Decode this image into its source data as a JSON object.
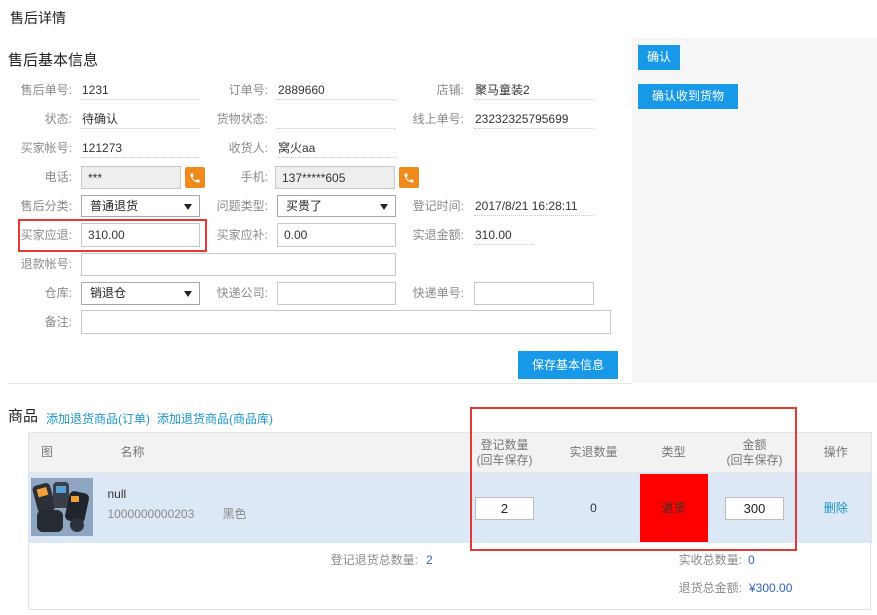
{
  "header": {
    "title": "售后详情"
  },
  "actions": {
    "confirm": "确认",
    "confirm_received": "确认收到货物"
  },
  "basic_info": {
    "title": "售后基本信息",
    "after_sale_no_label": "售后单号:",
    "after_sale_no": "1231",
    "order_no_label": "订单号:",
    "order_no": "2889660",
    "shop_label": "店铺:",
    "shop": "聚马童装2",
    "status_label": "状态:",
    "status": "待确认",
    "goods_status_label": "货物状态:",
    "online_no_label": "线上单号:",
    "online_no": "23232325795699",
    "buyer_account_label": "买家帐号:",
    "buyer_account": "121273",
    "receiver_label": "收货人:",
    "receiver": "窝火aa",
    "phone_label": "电话:",
    "phone": "***",
    "mobile_label": "手机:",
    "mobile": "137*****605",
    "category_label": "售后分类:",
    "category": "普通退货",
    "problem_type_label": "问题类型:",
    "problem_type": "买贵了",
    "register_time_label": "登记时间:",
    "register_time": "2017/8/21 16:28:11",
    "buyer_refund_label": "买家应退:",
    "buyer_refund": "310.00",
    "buyer_supplement_label": "买家应补:",
    "buyer_supplement": "0.00",
    "actual_refund_label": "实退金额:",
    "actual_refund": "310.00",
    "refund_account_label": "退款帐号:",
    "warehouse_label": "仓库:",
    "warehouse": "销退仓",
    "express_company_label": "快递公司:",
    "express_no_label": "快递单号:",
    "remark_label": "备注:",
    "save_button": "保存基本信息"
  },
  "goods": {
    "title": "商品",
    "add_from_order": "添加退货商品(订单)",
    "add_from_catalog": "添加退货商品(商品库)",
    "columns": {
      "image": "图",
      "name": "名称",
      "register_qty": "登记数量",
      "register_qty_hint": "(回车保存)",
      "actual_qty": "实退数量",
      "type": "类型",
      "amount": "金额",
      "amount_hint": "(回车保存)",
      "action": "操作"
    },
    "rows": [
      {
        "name": "null",
        "code": "1000000000203",
        "color": "黑色",
        "register_qty": "2",
        "actual_qty": "0",
        "type": "退货",
        "amount": "300",
        "action": "删除"
      }
    ],
    "summary": {
      "register_total_label": "登记退货总数量:",
      "register_total": "2",
      "received_total_label": "实收总数量:",
      "received_total": "0",
      "refund_total_label": "退货总金额:",
      "refund_total": "¥300.00"
    }
  },
  "icons": {
    "call_button": "phone-icon",
    "select_arrow": "caret-down-icon",
    "product_image": "product-thumbnail"
  },
  "colors": {
    "primary": "#1799e8",
    "phone_button": "#f08a1c",
    "link": "#1a95c7",
    "highlight": "#e53935",
    "type_cell": "#ff0000",
    "row_selected": "#dce8f6",
    "summary_value": "#2f63c4"
  }
}
